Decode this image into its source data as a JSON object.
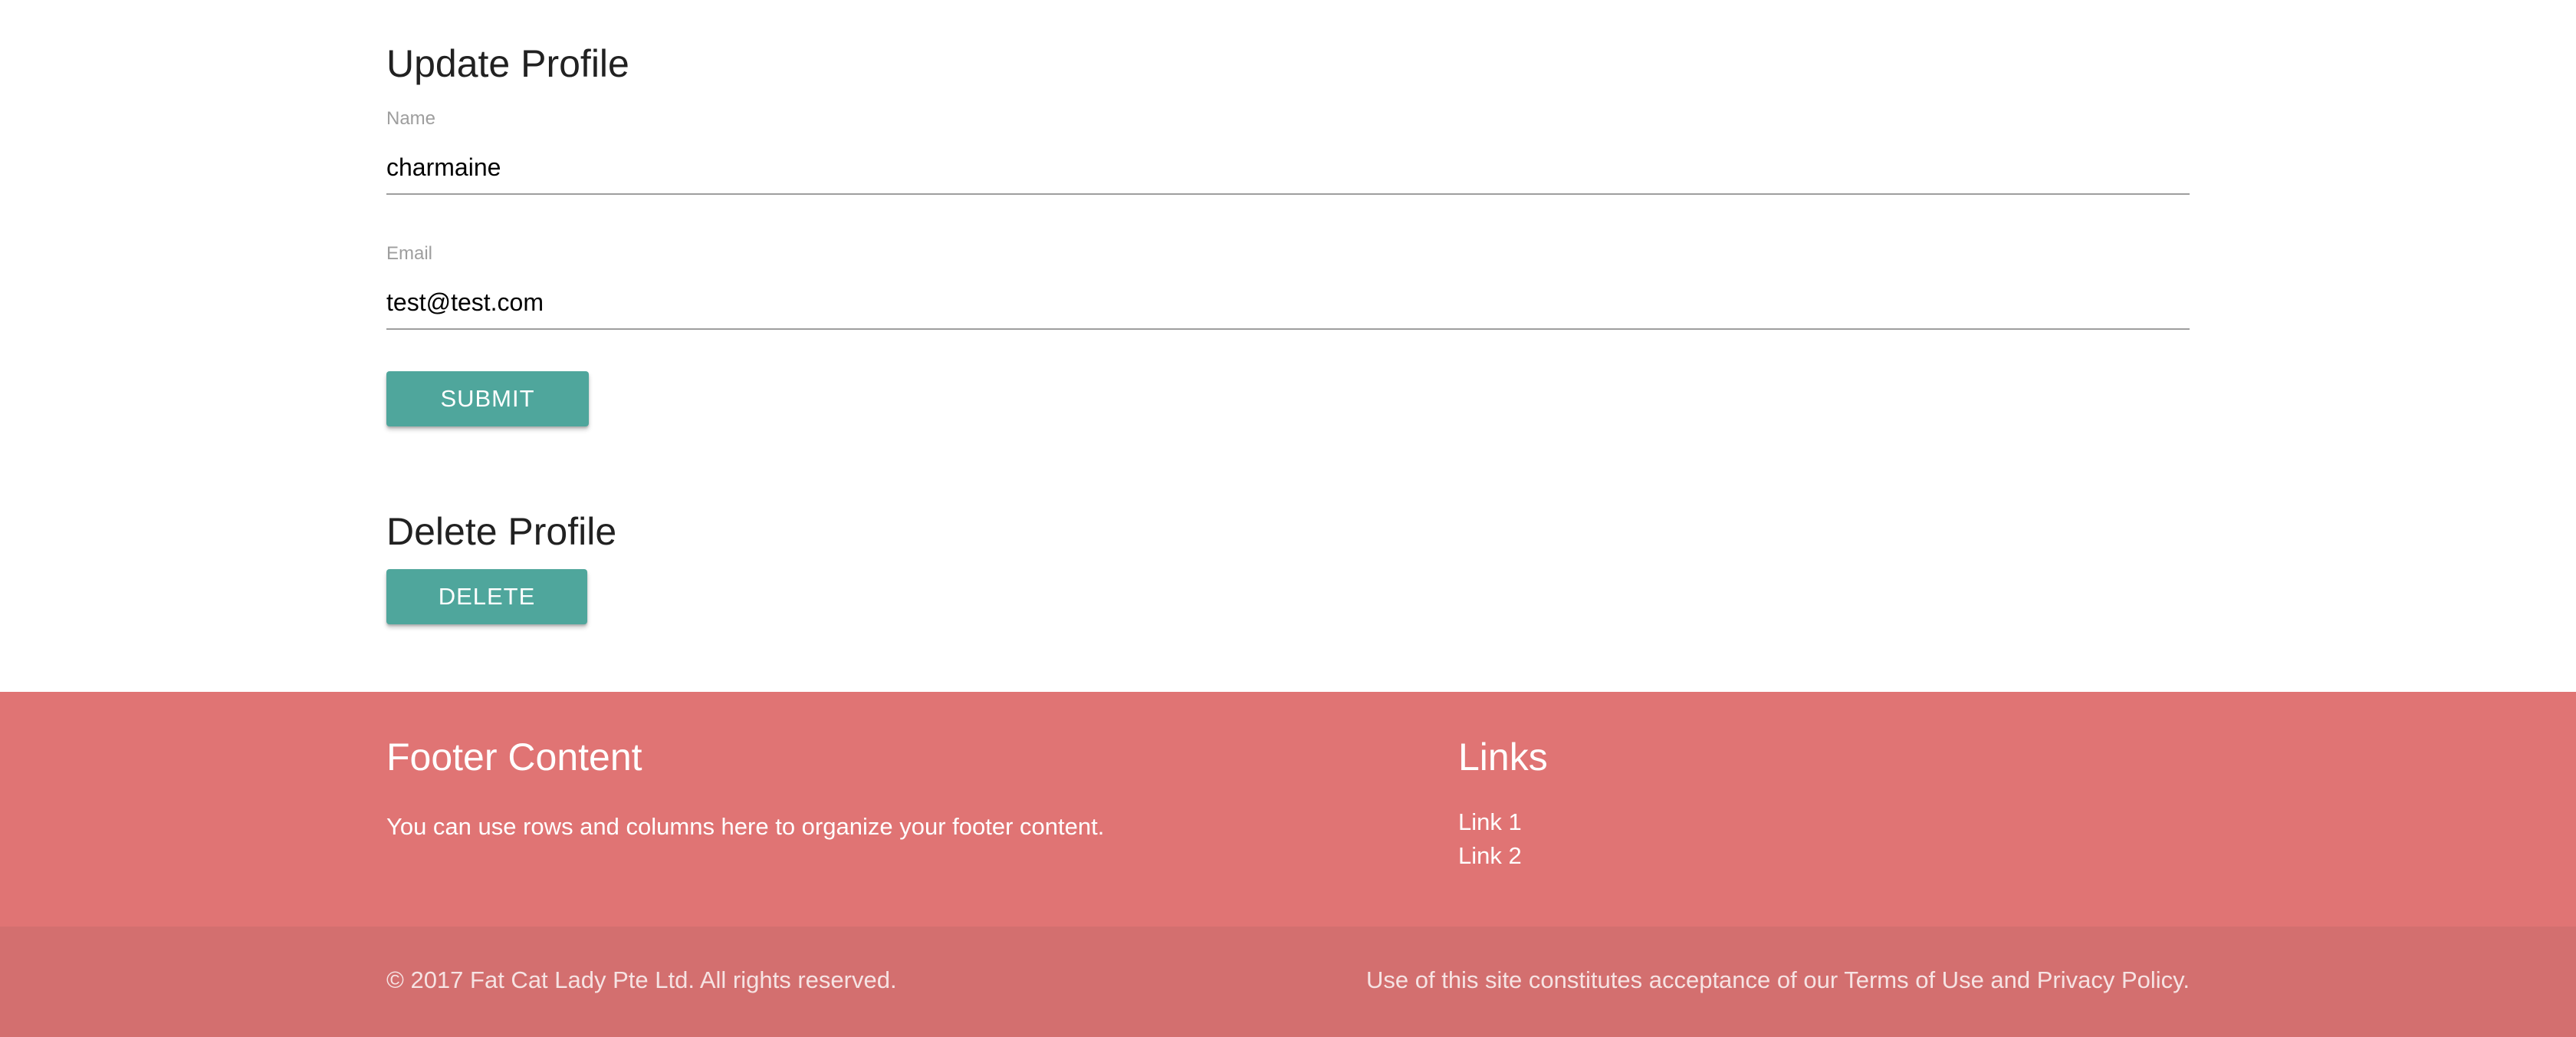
{
  "update_profile": {
    "title": "Update Profile",
    "name_label": "Name",
    "name_value": "charmaine",
    "email_label": "Email",
    "email_value": "test@test.com",
    "submit_label": "SUBMIT"
  },
  "delete_profile": {
    "title": "Delete Profile",
    "delete_label": "DELETE"
  },
  "footer": {
    "content_title": "Footer Content",
    "content_text": "You can use rows and columns here to organize your footer content.",
    "links_title": "Links",
    "links": [
      "Link 1",
      "Link 2"
    ],
    "copyright": "© 2017 Fat Cat Lady Pte Ltd. All rights reserved.",
    "terms_notice": "Use of this site constitutes acceptance of our Terms of Use and Privacy Policy."
  },
  "colors": {
    "button": "#4fa69c",
    "footer": "#e07474",
    "footer_copyright": "#d36f6f"
  }
}
